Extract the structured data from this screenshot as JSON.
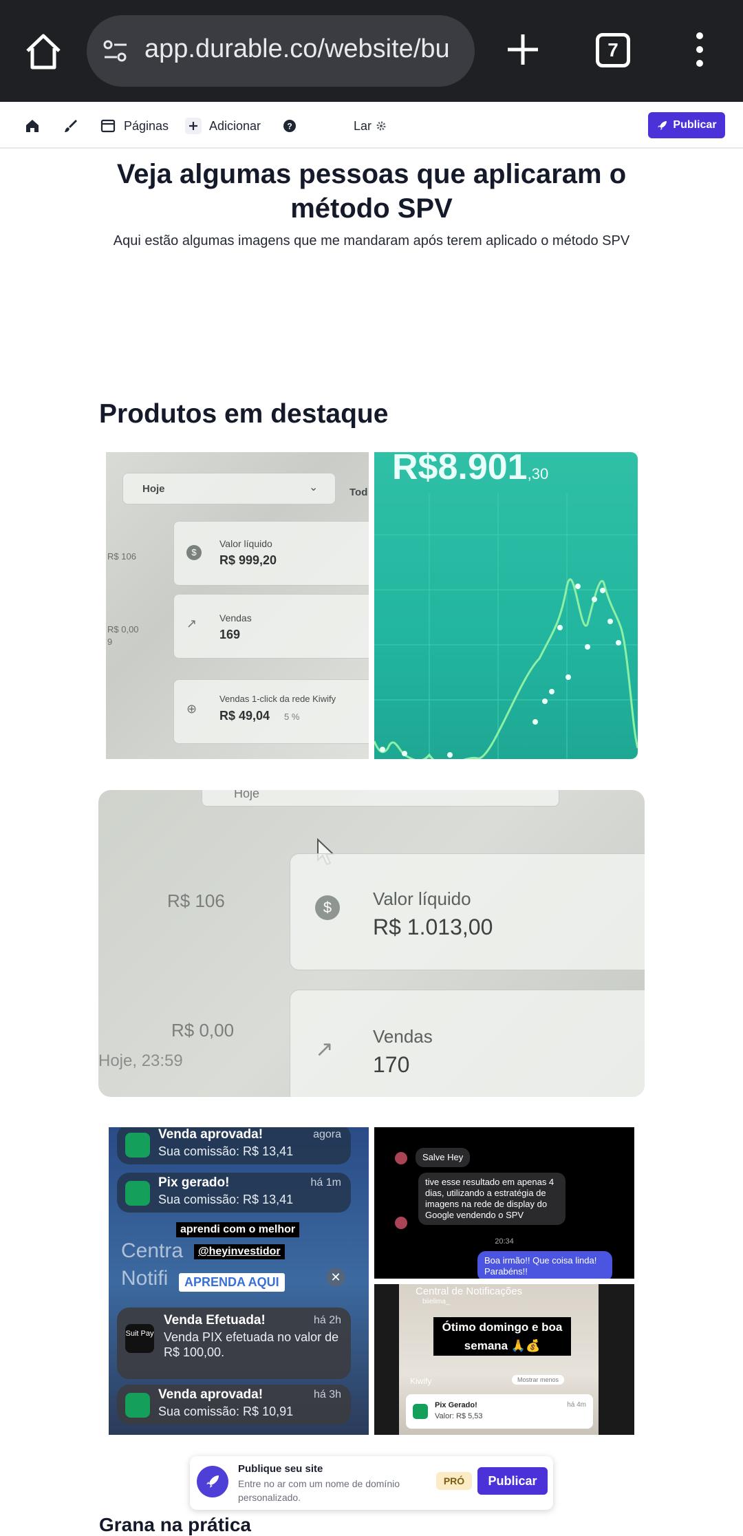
{
  "browser": {
    "url": "app.durable.co/website/bu",
    "tab_count": "7"
  },
  "toolbar": {
    "pages_label": "Páginas",
    "add_label": "Adicionar",
    "current_page": "Lar",
    "publish_label": "Publicar"
  },
  "content": {
    "headline": "Veja algumas pessoas que aplicaram o método SPV",
    "subtitle": "Aqui estão algumas imagens que me mandaram após terem aplicado o método SPV",
    "section_title": "Produtos em destaque",
    "next_heading": "Grana na prática"
  },
  "photos": {
    "p1": {
      "dropdown": "Hoje",
      "dropdown2": "Tod",
      "side_1": "R$ 106",
      "side_2": "R$ 0,00",
      "side_3": "9",
      "net_label": "Valor líquido",
      "net_value": "R$ 999,20",
      "sales_label": "Vendas",
      "sales_value": "169",
      "oneclick_label": "Vendas 1-click da rede Kiwify",
      "oneclick_value": "R$ 49,04",
      "oneclick_pct": "5 %"
    },
    "p2": {
      "amount": "R$8.901",
      "cents": ",30"
    },
    "p3": {
      "top_label": "Hoje",
      "side_1": "R$ 106",
      "side_2": "R$ 0,00",
      "side_3": "Hoje, 23:59",
      "net_label": "Valor líquido",
      "net_value": "R$ 1.013,00",
      "sales_label": "Vendas",
      "sales_value": "170"
    },
    "p4": {
      "n1_title": "Venda aprovada!",
      "n1_time": "agora",
      "n1_body": "Sua comissão: R$ 13,41",
      "n2_title": "Pix gerado!",
      "n2_time": "há 1m",
      "n2_body": "Sua comissão: R$ 13,41",
      "overlay_1": "aprendi com o melhor",
      "overlay_2": "@heyinvestidor",
      "overlay_3": "APRENDA AQUI",
      "bg_text": "Centra Notifi",
      "n3_title": "Venda Efetuada!",
      "n3_time": "há 2h",
      "n3_body": "Venda PIX efetuada no valor de R$ 100,00.",
      "n3_app": "Suit Pay",
      "n4_title": "Venda aprovada!",
      "n4_time": "há 3h",
      "n4_body": "Sua comissão: R$ 10,91"
    },
    "p5": {
      "msg1": "Salve Hey",
      "msg2": "tive esse resultado em apenas 4 dias, utilizando a estratégia de imagens na rede de display do Google vendendo o SPV",
      "time": "20:34",
      "msg3": "Boa irmão!! Que coisa linda! Parabéns!!"
    },
    "p6": {
      "header": "Central de Notificações",
      "user": "biielima_",
      "caption": "Ótimo domingo e boa semana 🙏💰",
      "show_less": "Mostrar menos",
      "brand": "Kiwify",
      "notif_title": "Pix Gerado!",
      "notif_body": "Valor: R$ 5,53",
      "notif_time": "há 4m"
    }
  },
  "banner": {
    "title": "Publique seu site",
    "text": "Entre no ar com um nome de domínio personalizado.",
    "badge": "PRÓ",
    "button": "Publicar"
  },
  "colors": {
    "accent": "#4a32d8",
    "browser_bg": "#1f2023",
    "teal": "#22b59f"
  }
}
